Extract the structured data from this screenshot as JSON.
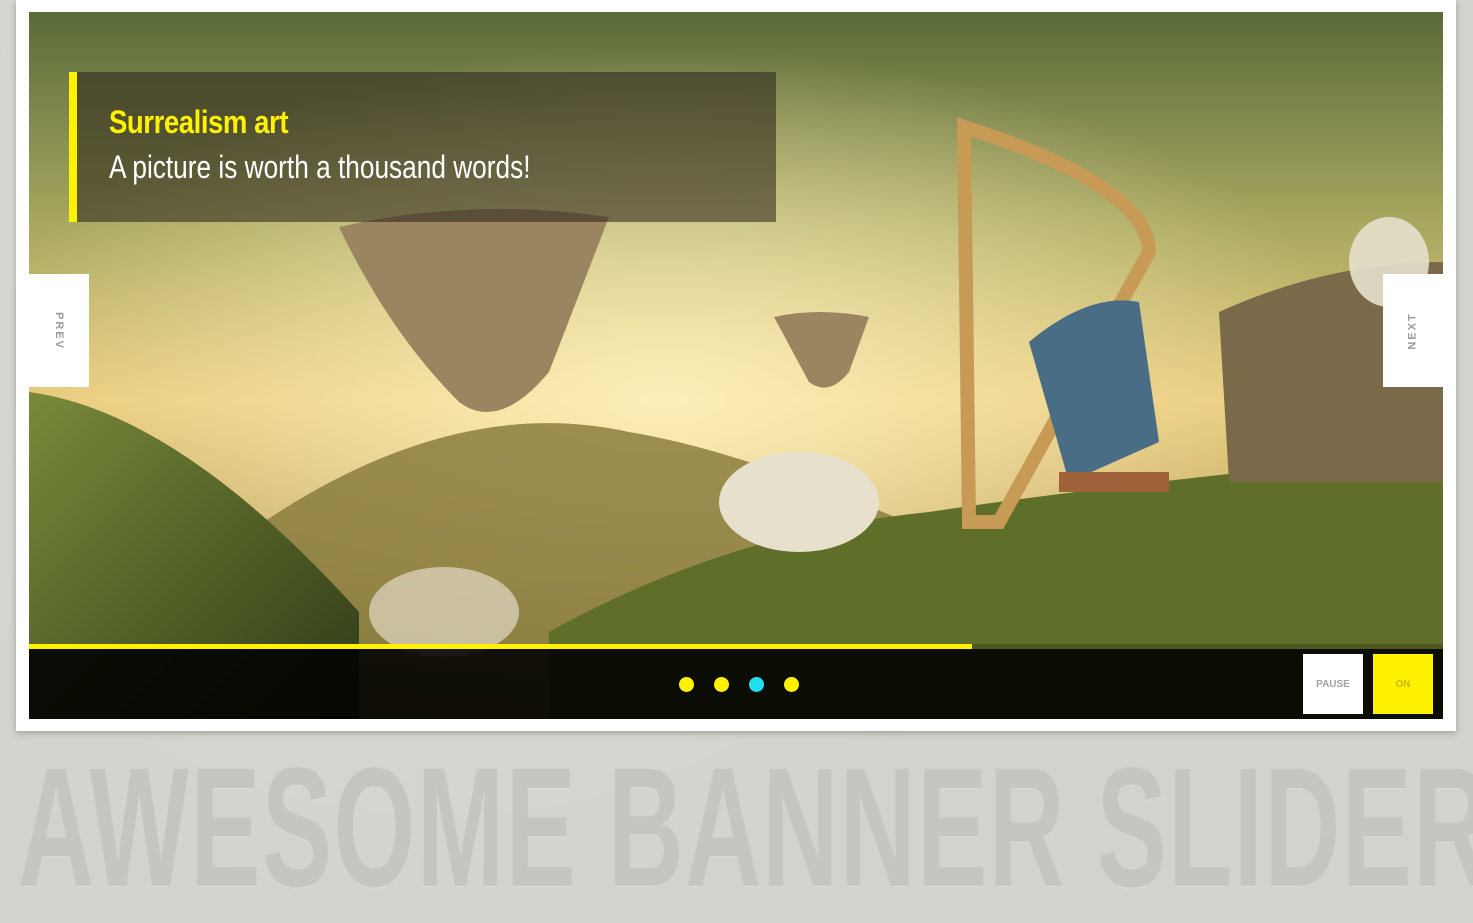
{
  "slider": {
    "caption": {
      "title": "Surrealism art",
      "subtitle": "A picture is worth a thousand words!"
    },
    "nav": {
      "prev_label": "PREV",
      "next_label": "NEXT"
    },
    "progress_fraction": 0.667,
    "dots": [
      {
        "active": false
      },
      {
        "active": false
      },
      {
        "active": true
      },
      {
        "active": false
      }
    ],
    "controls": {
      "pause_label": "PAUSE",
      "on_label": "ON"
    }
  },
  "colors": {
    "accent": "#fff200",
    "active_dot": "#1fe0ef",
    "caption_bg": "rgba(40,32,24,0.55)"
  },
  "footer": {
    "heading": "AWESOME BANNER SLIDER"
  }
}
